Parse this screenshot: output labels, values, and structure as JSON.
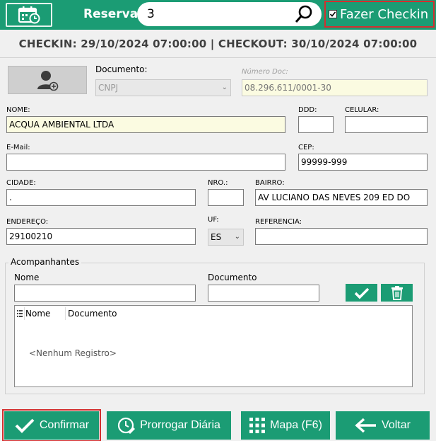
{
  "header": {
    "reserva_label": "Reserva",
    "search_value": "3",
    "checkin_label": "Fazer Checkin",
    "checkin_checked": true
  },
  "dates": {
    "text": "CHECKIN: 29/10/2024 07:00:00 | CHECKOUT: 30/10/2024 07:00:00"
  },
  "form": {
    "documento_label": "Documento:",
    "documento_value": "CNPJ",
    "numero_doc_label": "Número Doc:",
    "numero_doc_value": "08.296.611/0001-30",
    "nome_label": "NOME:",
    "nome_value": "ACQUA AMBIENTAL LTDA",
    "ddd_label": "DDD:",
    "ddd_value": "",
    "celular_label": "CELULAR:",
    "celular_value": "",
    "email_label": "E-Mail:",
    "email_value": "",
    "cep_label": "CEP:",
    "cep_value": "99999-999",
    "cidade_label": "CIDADE:",
    "cidade_value": ".",
    "nro_label": "NRO.:",
    "nro_value": "",
    "bairro_label": "BAIRRO:",
    "bairro_value": "AV LUCIANO DAS NEVES 209 ED DO",
    "endereco_label": "ENDEREÇO:",
    "endereco_value": "29100210",
    "uf_label": "UF:",
    "uf_value": "ES",
    "referencia_label": "REFERENCIA:",
    "referencia_value": ""
  },
  "companions": {
    "title": "Acompanhantes",
    "nome_label": "Nome",
    "documento_label": "Documento",
    "nome_value": "",
    "documento_value": "",
    "grid_headers": [
      "Nome",
      "Documento"
    ],
    "empty_text": "<Nenhum Registro>"
  },
  "footer": {
    "confirm": "Confirmar",
    "extend": "Prorrogar Diária",
    "map": "Mapa (F6)",
    "back": "Voltar"
  },
  "colors": {
    "accent": "#1b9c74",
    "highlight": "#d32f2f"
  }
}
